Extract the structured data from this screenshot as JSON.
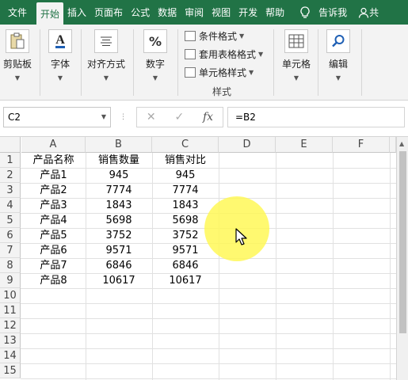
{
  "ribbon_tabs": [
    "文件",
    "开始",
    "插入",
    "页面布",
    "公式",
    "数据",
    "审阅",
    "视图",
    "开发",
    "帮助"
  ],
  "tell_me": "告诉我",
  "share": "共",
  "groups": {
    "clipboard": "剪贴板",
    "font": "字体",
    "alignment": "对齐方式",
    "number": "数字",
    "cells": "单元格",
    "editing": "编辑"
  },
  "styles": {
    "conditional": "条件格式",
    "table_format": "套用表格格式",
    "cell_styles": "单元格样式",
    "group_label": "样式"
  },
  "name_box": "C2",
  "formula": "=B2",
  "columns": [
    "A",
    "B",
    "C",
    "D",
    "E",
    "F"
  ],
  "rows": [
    "1",
    "2",
    "3",
    "4",
    "5",
    "6",
    "7",
    "8",
    "9",
    "10",
    "11",
    "12",
    "13",
    "14",
    "15"
  ],
  "table": {
    "header": [
      "产品名称",
      "销售数量",
      "销售对比"
    ],
    "data": [
      [
        "产品1",
        "945",
        "945"
      ],
      [
        "产品2",
        "7774",
        "7774"
      ],
      [
        "产品3",
        "1843",
        "1843"
      ],
      [
        "产品4",
        "5698",
        "5698"
      ],
      [
        "产品5",
        "3752",
        "3752"
      ],
      [
        "产品6",
        "9571",
        "9571"
      ],
      [
        "产品7",
        "6846",
        "6846"
      ],
      [
        "产品8",
        "10617",
        "10617"
      ]
    ]
  },
  "colors": {
    "excel_green": "#217346",
    "highlight": "#fff850"
  }
}
